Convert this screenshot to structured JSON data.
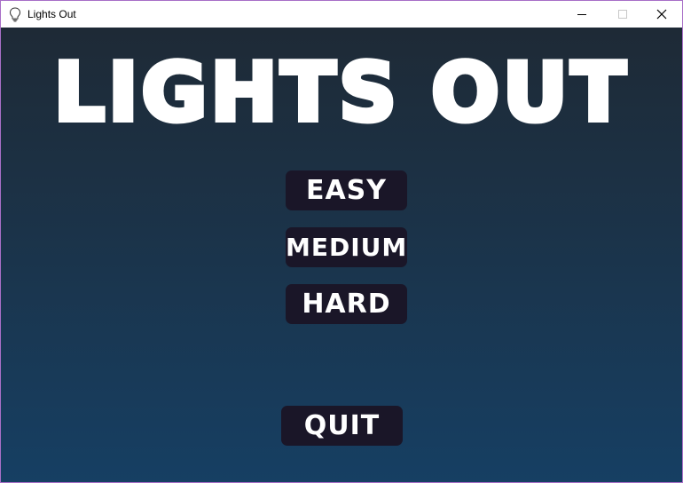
{
  "window": {
    "title": "Lights Out",
    "icon": "lightbulb-icon",
    "controls": [
      "minimize-icon",
      "maximize-icon",
      "close-icon"
    ]
  },
  "game": {
    "title": "LIGHTS OUT",
    "menu": {
      "easy_label": "EASY",
      "medium_label": "MEDIUM",
      "hard_label": "HARD",
      "quit_label": "QUIT"
    }
  },
  "colors": {
    "background_top": "#1e2a36",
    "background_bottom": "#163f63",
    "button_bg": "#1a1628",
    "text": "#ffffff",
    "window_border": "#a86fc7"
  }
}
